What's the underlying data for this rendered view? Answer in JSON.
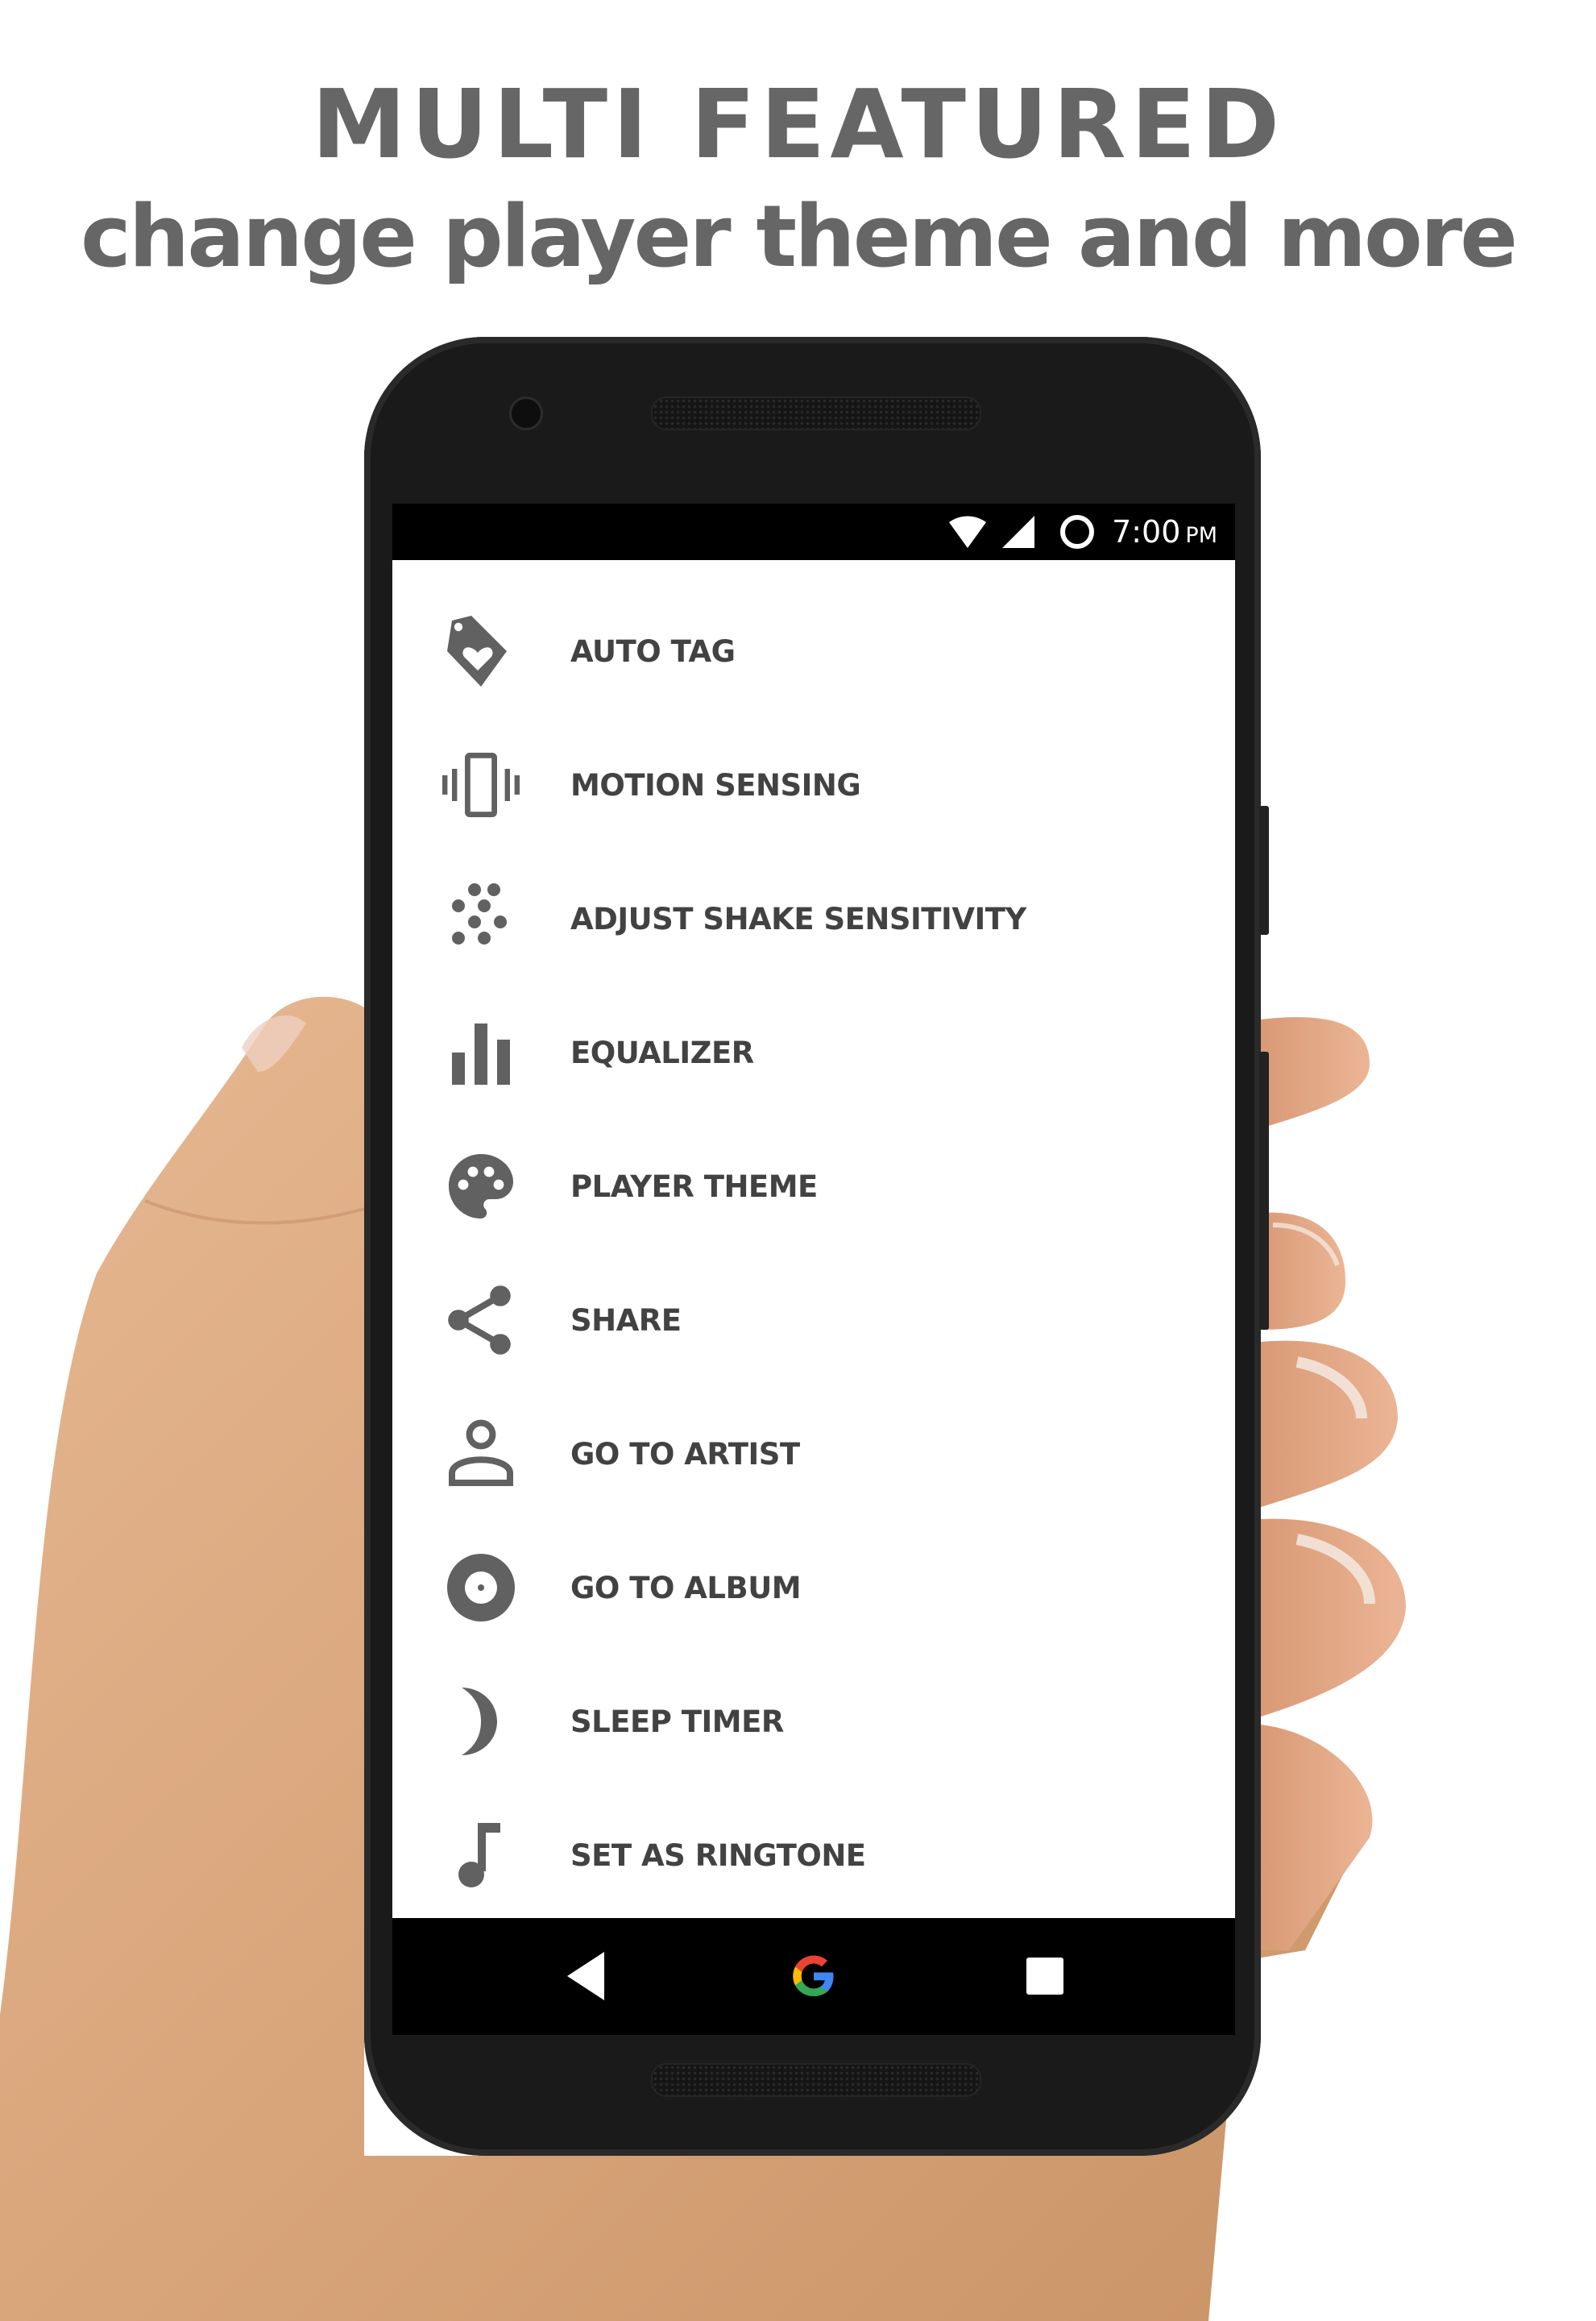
{
  "headline": {
    "title": "MULTI  FEATURED",
    "subtitle": "change player theme and more"
  },
  "status_bar": {
    "time": "7:00",
    "ampm": "PM",
    "icons": [
      "wifi-icon",
      "signal-icon",
      "sync-circle-icon"
    ]
  },
  "menu": {
    "items": [
      {
        "label": "AUTO TAG",
        "icon": "tag-heart-icon"
      },
      {
        "label": "MOTION SENSING",
        "icon": "vibration-icon"
      },
      {
        "label": "ADJUST SHAKE SENSITIVITY",
        "icon": "dots-sensitivity-icon"
      },
      {
        "label": "EQUALIZER",
        "icon": "equalizer-icon"
      },
      {
        "label": "PLAYER THEME",
        "icon": "palette-icon"
      },
      {
        "label": "SHARE",
        "icon": "share-icon"
      },
      {
        "label": "GO TO ARTIST",
        "icon": "person-icon"
      },
      {
        "label": "GO TO ALBUM",
        "icon": "album-icon"
      },
      {
        "label": "SLEEP TIMER",
        "icon": "moon-icon"
      },
      {
        "label": "SET AS RINGTONE",
        "icon": "music-note-icon"
      }
    ]
  },
  "nav_bar": {
    "buttons": [
      "back-icon",
      "google-home-icon",
      "recents-icon"
    ]
  },
  "colors": {
    "headline": "#666666",
    "icon": "#616161",
    "label": "#424242",
    "google_red": "#EA4335",
    "google_yellow": "#FBBC05",
    "google_green": "#34A853",
    "google_blue": "#4285F4"
  }
}
